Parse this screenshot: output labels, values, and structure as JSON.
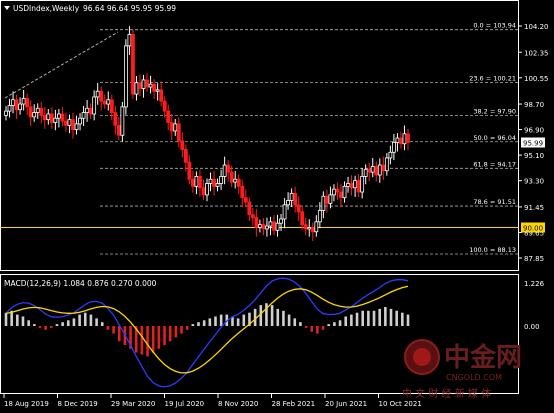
{
  "header": {
    "symbol": "USDIndex,Weekly",
    "ohlc": "96.64 96.64 95.95 95.99"
  },
  "price_axis": {
    "ticks": [
      "104.20",
      "102.35",
      "100.55",
      "98.70",
      "96.90",
      "95.10",
      "93.30",
      "91.45",
      "89.65",
      "87.85"
    ],
    "current_price": "95.99",
    "hline_price": "90.00"
  },
  "fibonacci": [
    {
      "level": "0.0",
      "value": "103.94",
      "price": 103.94
    },
    {
      "level": "23.6",
      "value": "100.21",
      "price": 100.21
    },
    {
      "level": "38.2",
      "value": "97.90",
      "price": 97.9
    },
    {
      "level": "50.0",
      "value": "96.04",
      "price": 96.04
    },
    {
      "level": "61.8",
      "value": "94.17",
      "price": 94.17
    },
    {
      "level": "78.6",
      "value": "91.51",
      "price": 91.51
    },
    {
      "level": "100.0",
      "value": "88.13",
      "price": 88.13
    }
  ],
  "macd": {
    "title": "MACD(12,26,9) 1.084 0.876 0.270 0.000",
    "ticks": [
      "1.226",
      "0.00"
    ],
    "histogram": [
      0.35,
      0.4,
      0.3,
      0.25,
      0.15,
      0.05,
      -0.05,
      -0.1,
      -0.05,
      0.05,
      0.1,
      0.15,
      0.2,
      0.3,
      0.35,
      0.3,
      0.2,
      0.1,
      -0.1,
      -0.2,
      -0.4,
      -0.5,
      -0.6,
      -0.7,
      -0.75,
      -0.8,
      -0.7,
      -0.6,
      -0.5,
      -0.4,
      -0.3,
      -0.2,
      -0.1,
      0.05,
      0.1,
      0.15,
      0.2,
      0.25,
      0.3,
      0.3,
      0.25,
      0.2,
      0.3,
      0.35,
      0.45,
      0.55,
      0.6,
      0.55,
      0.45,
      0.4,
      0.3,
      0.2,
      0.1,
      -0.05,
      -0.15,
      -0.2,
      -0.1,
      0.05,
      0.1,
      0.15,
      0.25,
      0.3,
      0.35,
      0.4,
      0.4,
      0.4,
      0.45,
      0.5,
      0.45,
      0.4,
      0.35,
      0.3
    ]
  },
  "time_axis": [
    "18 Aug 2019",
    "8 Dec 2019",
    "29 Mar 2020",
    "19 Jul 2020",
    "8 Nov 2020",
    "28 Feb 2021",
    "20 Jun 2021",
    "10 Oct 2021"
  ],
  "watermark": {
    "brand": "中金网",
    "domain": "CNGOLD.COM",
    "tagline": "中 文 财 经 新 媒 体"
  },
  "colors": {
    "background": "#000000",
    "bull": "#ffffff",
    "bear": "#ff1c1c",
    "hline": "#ffd700",
    "fib": "#b0b0b0",
    "macd_line": "#2a3cff",
    "signal_line": "#ffd700",
    "hist_pos": "#cfcfcf",
    "hist_neg": "#e22020"
  },
  "chart_data": {
    "type": "candlestick",
    "title": "USDIndex,Weekly",
    "ylim": [
      87.85,
      104.2
    ],
    "x_labels": [
      "18 Aug 2019",
      "8 Dec 2019",
      "29 Mar 2020",
      "19 Jul 2020",
      "8 Nov 2020",
      "28 Feb 2021",
      "20 Jun 2021",
      "10 Oct 2021"
    ],
    "closes": [
      98.2,
      98.6,
      99.0,
      98.3,
      98.7,
      99.1,
      98.5,
      97.8,
      98.1,
      98.4,
      97.9,
      97.6,
      98.0,
      97.4,
      97.7,
      98.0,
      97.5,
      97.2,
      97.6,
      96.9,
      97.3,
      97.7,
      98.1,
      98.4,
      98.0,
      99.2,
      99.6,
      98.9,
      98.7,
      99.0,
      98.1,
      97.2,
      96.5,
      98.5,
      102.8,
      103.6,
      99.4,
      100.2,
      99.8,
      100.4,
      99.9,
      100.1,
      99.6,
      99.7,
      98.9,
      98.2,
      97.4,
      96.8,
      97.3,
      96.1,
      95.5,
      94.6,
      93.4,
      92.9,
      93.6,
      92.8,
      92.3,
      93.1,
      93.4,
      92.9,
      93.1,
      93.6,
      94.4,
      93.9,
      93.2,
      93.4,
      92.9,
      92.1,
      91.8,
      90.9,
      90.7,
      90.0,
      90.2,
      89.9,
      90.1,
      90.4,
      89.8,
      90.3,
      90.6,
      91.6,
      91.9,
      92.4,
      91.6,
      91.1,
      90.2,
      89.9,
      90.0,
      89.7,
      90.4,
      91.2,
      92.2,
      91.7,
      92.3,
      92.7,
      92.5,
      92.1,
      92.9,
      93.1,
      92.8,
      93.3,
      92.5,
      93.6,
      94.1,
      93.9,
      94.3,
      93.7,
      94.4,
      94.0,
      94.9,
      95.3,
      96.0,
      96.3,
      95.9,
      96.6,
      96.0
    ]
  }
}
